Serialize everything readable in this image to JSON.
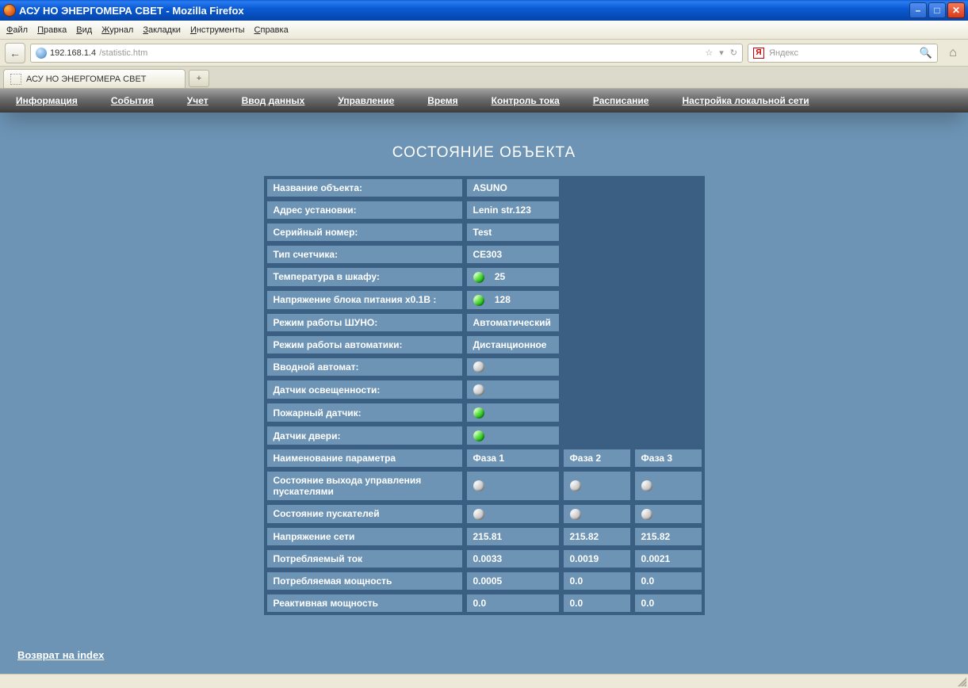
{
  "window": {
    "title": "АСУ НО ЭНЕРГОМЕРА СВЕТ - Mozilla Firefox"
  },
  "browser_menu": [
    "Файл",
    "Правка",
    "Вид",
    "Журнал",
    "Закладки",
    "Инструменты",
    "Справка"
  ],
  "url": {
    "host": "192.168.1.4",
    "path": "/statistic.htm"
  },
  "search": {
    "engine_badge": "Я",
    "placeholder": "Яндекс"
  },
  "tab": {
    "title": "АСУ НО ЭНЕРГОМЕРА СВЕТ"
  },
  "site_nav": [
    "Информация",
    "События",
    "Учет",
    "Ввод данных",
    "Управление",
    "Время",
    "Контроль тока",
    "Расписание",
    "Настройка локальной сети"
  ],
  "page": {
    "title": "СОСТОЯНИЕ ОБЪЕКТА",
    "return_label": "Возврат на index"
  },
  "status_rows": [
    {
      "label": "Название объекта:",
      "value": "ASUNO",
      "kind": "text"
    },
    {
      "label": "Адрес установки:",
      "value": "Lenin str.123",
      "kind": "text"
    },
    {
      "label": "Серийный номер:",
      "value": "Test",
      "kind": "text"
    },
    {
      "label": "Тип счетчика:",
      "value": "СЕ303",
      "kind": "text"
    },
    {
      "label": "Температура в шкафу:",
      "value": "25",
      "kind": "led_text",
      "led": "green"
    },
    {
      "label": "Напряжение блока питания х0.1В :",
      "value": "128",
      "kind": "led_text",
      "led": "green"
    },
    {
      "label": "Режим работы ШУНО:",
      "value": "Автоматический",
      "kind": "text"
    },
    {
      "label": "Режим работы автоматики:",
      "value": "Дистанционное",
      "kind": "text"
    },
    {
      "label": "Вводной автомат:",
      "kind": "led",
      "led": "gray"
    },
    {
      "label": "Датчик освещенности:",
      "kind": "led",
      "led": "gray"
    },
    {
      "label": "Пожарный датчик:",
      "kind": "led",
      "led": "green"
    },
    {
      "label": "Датчик двери:",
      "kind": "led",
      "led": "green"
    }
  ],
  "phase_header": {
    "label": "Наименование параметра",
    "p1": "Фаза 1",
    "p2": "Фаза 2",
    "p3": "Фаза 3"
  },
  "phase_rows": [
    {
      "label": "Состояние выхода управления пускателями",
      "kind": "led3",
      "l1": "gray",
      "l2": "gray",
      "l3": "gray"
    },
    {
      "label": "Состояние пускателей",
      "kind": "led3",
      "l1": "gray",
      "l2": "gray",
      "l3": "gray"
    },
    {
      "label": "Напряжение сети",
      "kind": "num3",
      "v1": "215.81",
      "v2": "215.82",
      "v3": "215.82"
    },
    {
      "label": "Потребляемый ток",
      "kind": "num3",
      "v1": "0.0033",
      "v2": "0.0019",
      "v3": "0.0021"
    },
    {
      "label": "Потребляемая мощность",
      "kind": "num3",
      "v1": "0.0005",
      "v2": "0.0",
      "v3": "0.0"
    },
    {
      "label": "Реактивная мощность",
      "kind": "num3",
      "v1": "0.0",
      "v2": "0.0",
      "v3": "0.0"
    }
  ]
}
